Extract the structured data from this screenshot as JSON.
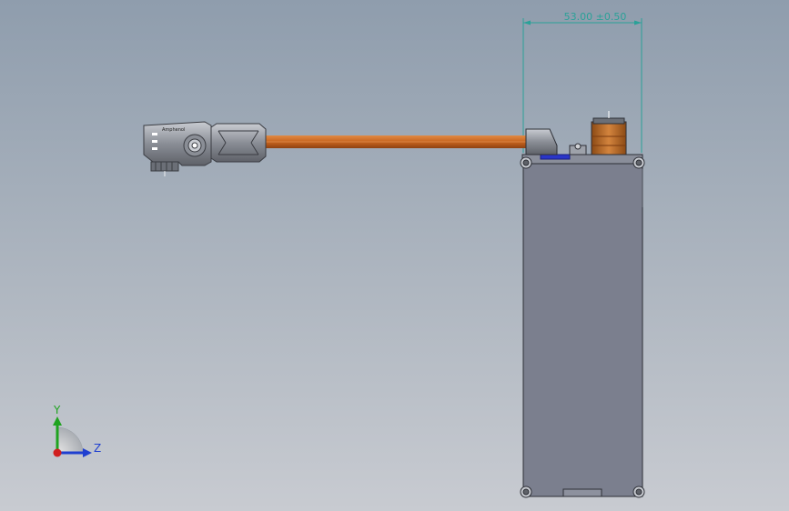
{
  "viewport": {
    "dimension_label": "53.00 ±0.50",
    "connector_label": "Amphenol"
  },
  "triad": {
    "y_label": "Y",
    "z_label": "Z",
    "y_color": "#1fa31f",
    "z_color": "#1f3fd0",
    "x_color": "#d01f1f"
  },
  "colors": {
    "cable": "#c8651e",
    "body": "#7b7f8e",
    "dimension": "#2aa198",
    "spool": "#b8651e"
  }
}
